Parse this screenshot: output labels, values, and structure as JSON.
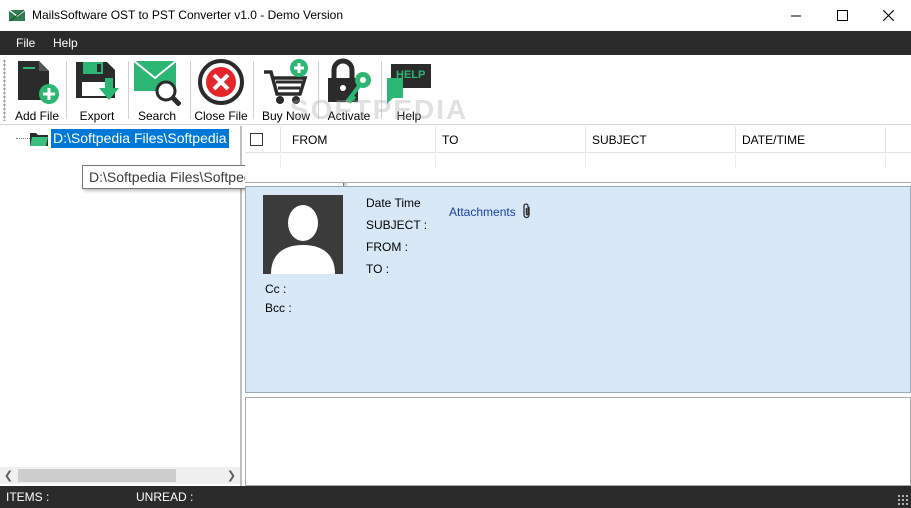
{
  "window": {
    "title": "MailsSoftware OST to PST Converter v1.0 - Demo Version"
  },
  "menu": {
    "file": "File",
    "help": "Help"
  },
  "toolbar": {
    "add_file": "Add File",
    "export": "Export",
    "search": "Search",
    "close_file": "Close File",
    "buy_now": "Buy Now",
    "activate": "Activate",
    "help": "Help",
    "help_badge": "HELP"
  },
  "watermark": "SOFTPEDIA",
  "tree": {
    "root_label": "D:\\Softpedia Files\\Softpedia"
  },
  "tooltip": "D:\\Softpedia Files\\Softpedia Outlook.ost",
  "grid": {
    "columns": [
      "FROM",
      "TO",
      "SUBJECT",
      "DATE/TIME"
    ]
  },
  "preview": {
    "date_time": "Date Time",
    "subject": "SUBJECT :",
    "from": "FROM  :",
    "to": "TO :",
    "cc": "Cc :",
    "bcc": "Bcc :",
    "attachments": "Attachments"
  },
  "status": {
    "items": "ITEMS :",
    "unread": "UNREAD :"
  },
  "colors": {
    "menubar": "#2b2b2b",
    "accent_green": "#2bb673",
    "selection": "#0078d7",
    "preview_bg": "#d8e8f6"
  }
}
